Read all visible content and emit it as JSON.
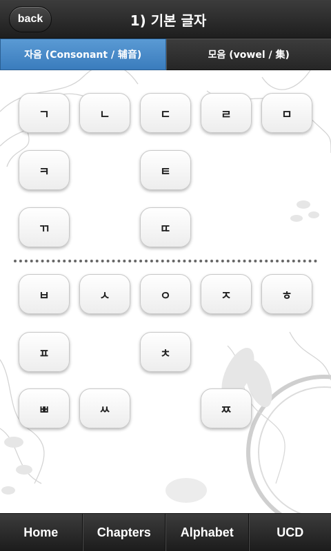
{
  "header": {
    "back_label": "back",
    "title": "1) 기본 글자"
  },
  "tabs": [
    {
      "label": "자음 (Consonant / 辅音)",
      "active": true
    },
    {
      "label": "모음 (vowel / 集)",
      "active": false
    }
  ],
  "top_keys": [
    "ㄱ",
    "ㄴ",
    "ㄷ",
    "ㄹ",
    "ㅁ",
    "ㅋ",
    "ㅌ",
    "ㄲ",
    "ㄸ"
  ],
  "bottom_keys": [
    "ㅂ",
    "ㅅ",
    "ㅇ",
    "ㅈ",
    "ㅎ",
    "ㅍ",
    "ㅊ",
    "ㅃ",
    "ㅆ",
    "ㅉ"
  ],
  "bottom_nav": [
    "Home",
    "Chapters",
    "Alphabet",
    "UCD"
  ],
  "colors": {
    "header_bg": "#2a2a2a",
    "tab_active": "#4a8ac9",
    "key_bg": "#f4f4f4"
  }
}
